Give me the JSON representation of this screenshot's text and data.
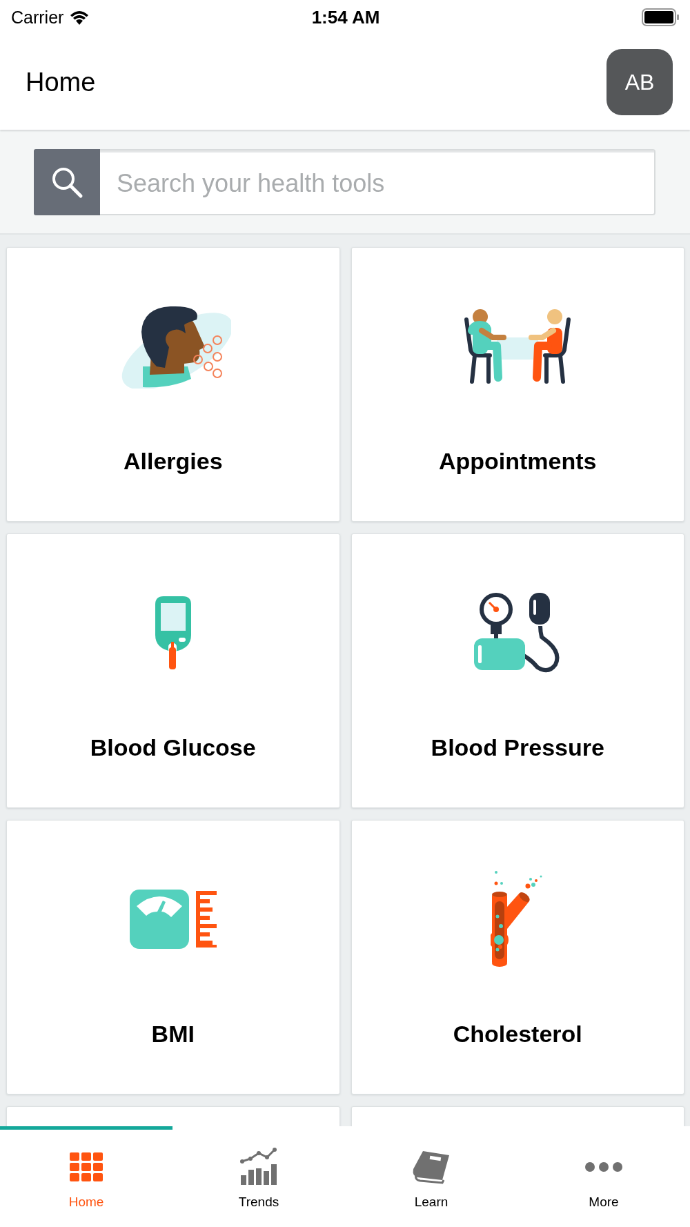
{
  "status_bar": {
    "carrier": "Carrier",
    "time": "1:54 AM"
  },
  "header": {
    "title": "Home",
    "avatar": "AB"
  },
  "search": {
    "placeholder": "Search your health tools"
  },
  "tiles": [
    {
      "kind": "tool",
      "label": "Allergies"
    },
    {
      "kind": "tool",
      "label": "Appointments"
    },
    {
      "kind": "tool",
      "label": "Blood Glucose"
    },
    {
      "kind": "tool",
      "label": "Blood Pressure"
    },
    {
      "kind": "tool",
      "label": "BMI"
    },
    {
      "kind": "tool",
      "label": "Cholesterol"
    },
    {
      "kind": "clipped"
    },
    {
      "kind": "clipped"
    }
  ],
  "tabs": [
    {
      "label": "Home",
      "selected": true
    },
    {
      "label": "Trends",
      "selected": false
    },
    {
      "label": "Learn",
      "selected": false
    },
    {
      "label": "More",
      "selected": false
    }
  ]
}
